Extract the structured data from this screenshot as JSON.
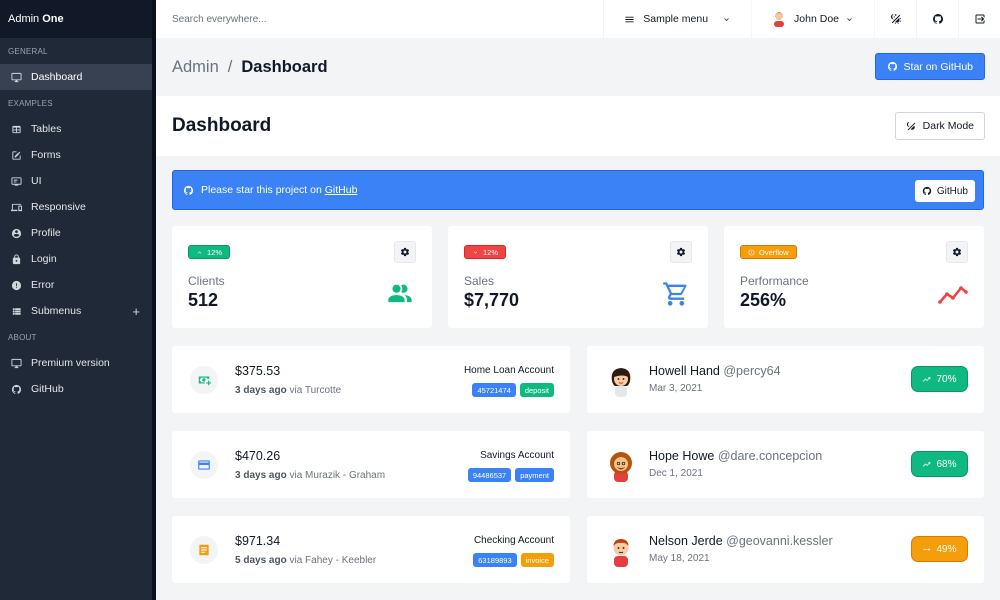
{
  "sidebar": {
    "brand_a": "Admin",
    "brand_b": "One",
    "sections": [
      "GENERAL",
      "EXAMPLES",
      "ABOUT"
    ],
    "general": [
      {
        "label": "Dashboard",
        "icon": "monitor-icon"
      }
    ],
    "examples": [
      {
        "label": "Tables",
        "icon": "table-icon"
      },
      {
        "label": "Forms",
        "icon": "edit-icon"
      },
      {
        "label": "UI",
        "icon": "tv-icon"
      },
      {
        "label": "Responsive",
        "icon": "responsive-icon"
      },
      {
        "label": "Profile",
        "icon": "account-circle-icon"
      },
      {
        "label": "Login",
        "icon": "lock-icon"
      },
      {
        "label": "Error",
        "icon": "alert-circle-icon"
      },
      {
        "label": "Submenus",
        "icon": "view-list-icon",
        "expander": "+"
      }
    ],
    "about": [
      {
        "label": "Premium version",
        "icon": "monitor-icon"
      },
      {
        "label": "GitHub",
        "icon": "github-icon"
      }
    ]
  },
  "topnav": {
    "search_placeholder": "Search everywhere...",
    "menu_label": "Sample menu",
    "user_name": "John Doe"
  },
  "titlebar": {
    "crumb_parent": "Admin",
    "crumb_sep": "/",
    "crumb_current": "Dashboard",
    "star_button": "Star on GitHub"
  },
  "hero": {
    "title": "Dashboard",
    "dark_mode_button": "Dark Mode"
  },
  "notification": {
    "text": "Please star this project on",
    "link": "GitHub",
    "button": "GitHub"
  },
  "widgets": [
    {
      "trend": "12%",
      "trend_dir": "up",
      "label": "Clients",
      "value": "512",
      "icon": "account-multiple-icon",
      "color": "#10b981"
    },
    {
      "trend": "12%",
      "trend_dir": "down",
      "label": "Sales",
      "value": "$7,770",
      "icon": "cart-icon",
      "color": "#3b82f6"
    },
    {
      "trend": "Overflow",
      "trend_dir": "overflow",
      "label": "Performance",
      "value": "256%",
      "icon": "chart-line-icon",
      "color": "#ef4444"
    }
  ],
  "transactions": [
    {
      "amount": "$375.53",
      "when": "3 days ago",
      "via": "via Turcotte",
      "account": "Home Loan Account",
      "number": "45721474",
      "type": "deposit",
      "type_color": "green",
      "icon": "cash-plus-icon",
      "icon_color": "#10b981"
    },
    {
      "amount": "$470.26",
      "when": "3 days ago",
      "via": "via Murazik - Graham",
      "account": "Savings Account",
      "number": "94486537",
      "type": "payment",
      "type_color": "blue",
      "icon": "credit-card-icon",
      "icon_color": "#3b82f6"
    },
    {
      "amount": "$971.34",
      "when": "5 days ago",
      "via": "via Fahey - Keebler",
      "account": "Checking Account",
      "number": "63189893",
      "type": "invoice",
      "type_color": "yellow",
      "icon": "receipt-icon",
      "icon_color": "#f59e0b"
    }
  ],
  "clients": [
    {
      "name": "Howell Hand",
      "handle": "@percy64",
      "date": "Mar 3, 2021",
      "progress": "70%",
      "trend": "up",
      "color": "green"
    },
    {
      "name": "Hope Howe",
      "handle": "@dare.concepcion",
      "date": "Dec 1, 2021",
      "progress": "68%",
      "trend": "up",
      "color": "green"
    },
    {
      "name": "Nelson Jerde",
      "handle": "@geovanni.kessler",
      "date": "May 18, 2021",
      "progress": "49%",
      "trend": "flat",
      "color": "yellow"
    }
  ]
}
